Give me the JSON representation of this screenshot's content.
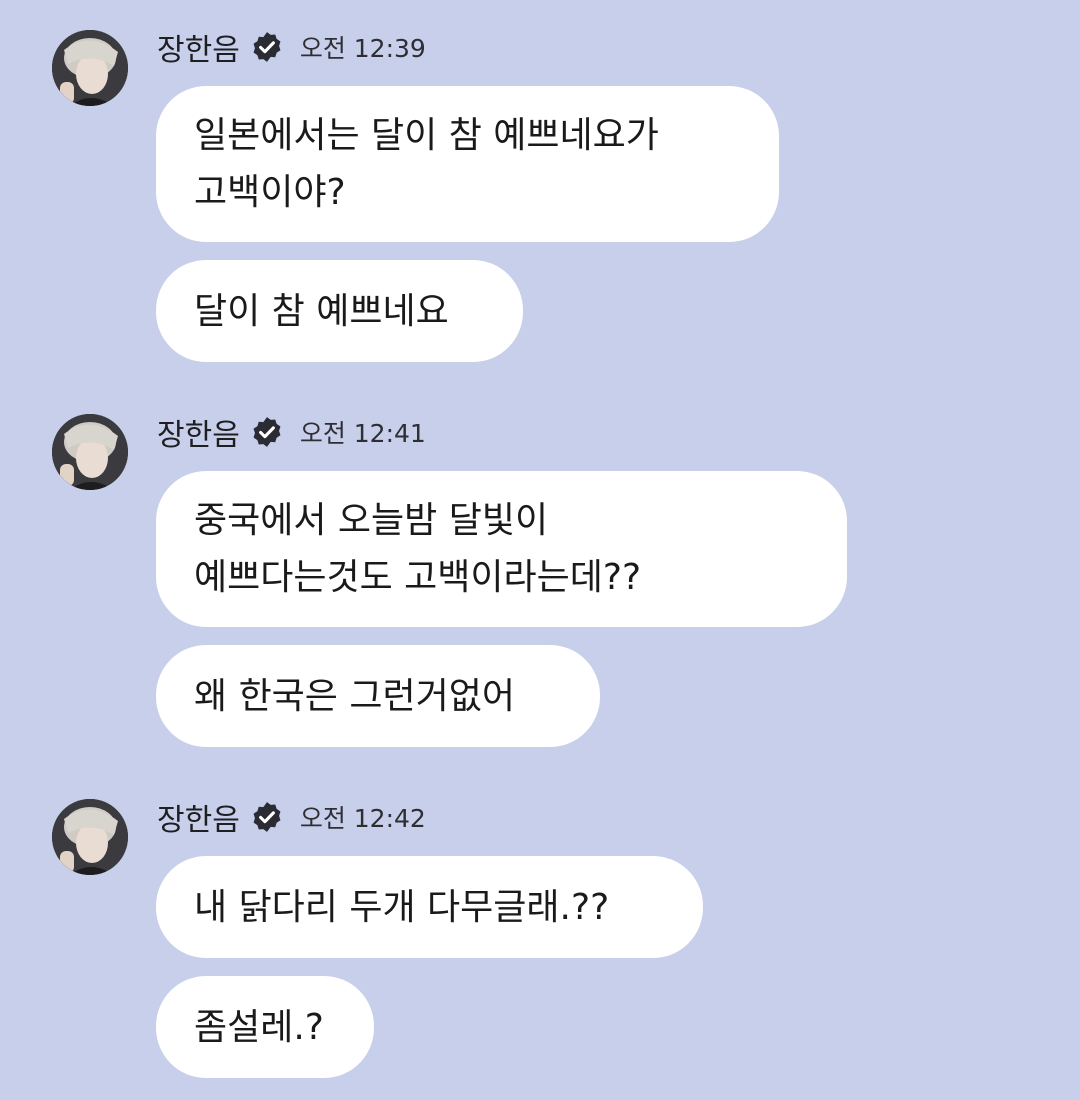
{
  "colors": {
    "background": "#c7cfea",
    "bubble": "#ffffff",
    "verified_badge": "#2b2b33"
  },
  "icons": {
    "verified": "verified-badge-icon",
    "avatar": "profile-photo"
  },
  "groups": [
    {
      "sender": "장한음",
      "time": "오전 12:39",
      "messages": [
        {
          "lines": [
            "일본에서는 달이 참 예쁘네요가",
            "고백이야?"
          ]
        },
        {
          "lines": [
            "달이 참 예쁘네요"
          ]
        }
      ]
    },
    {
      "sender": "장한음",
      "time": "오전 12:41",
      "messages": [
        {
          "lines": [
            "중국에서 오늘밤 달빛이",
            "예쁘다는것도 고백이라는데??"
          ]
        },
        {
          "lines": [
            "왜 한국은 그런거없어"
          ]
        }
      ]
    },
    {
      "sender": "장한음",
      "time": "오전 12:42",
      "messages": [
        {
          "lines": [
            "내 닭다리 두개 다무글래.??"
          ]
        },
        {
          "lines": [
            "좀설레.?"
          ]
        }
      ]
    }
  ]
}
